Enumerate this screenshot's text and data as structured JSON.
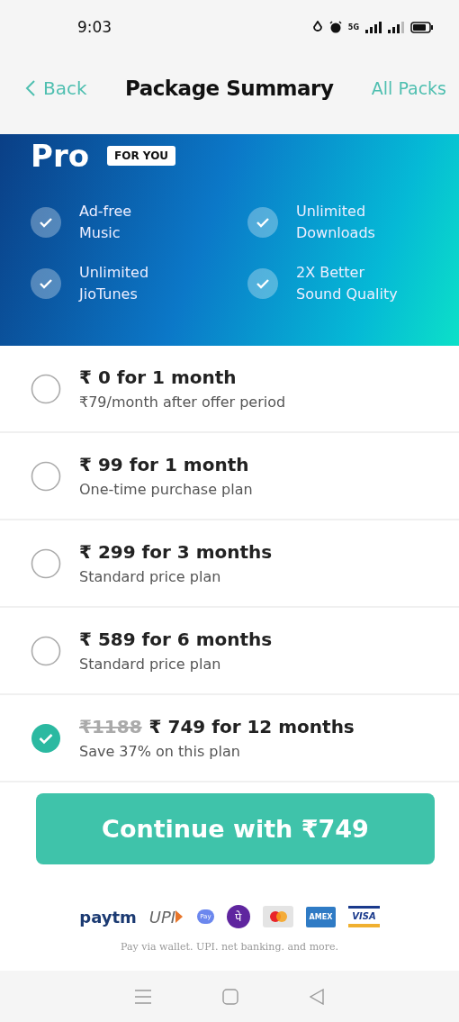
{
  "status_bar": {
    "time": "9:03",
    "network_label": "5G"
  },
  "header": {
    "back": "Back",
    "title": "Package Summary",
    "action": "All Packs"
  },
  "banner": {
    "title": "Pro",
    "badge": "FOR YOU",
    "features": [
      {
        "text": "Ad-free\nMusic"
      },
      {
        "text": "Unlimited\nDownloads"
      },
      {
        "text": "Unlimited\nJioTunes"
      },
      {
        "text": "2X Better\nSound Quality"
      }
    ]
  },
  "plans": [
    {
      "title": "₹ 0 for 1 month",
      "subtitle": "₹79/month after offer period",
      "selected": false
    },
    {
      "title": "₹ 99 for 1 month",
      "subtitle": "One-time purchase plan",
      "selected": false
    },
    {
      "title": "₹ 299 for 3 months",
      "subtitle": "Standard price plan",
      "selected": false
    },
    {
      "title": "₹ 589 for 6 months",
      "subtitle": "Standard price plan",
      "selected": false
    },
    {
      "original_price": "₹1188",
      "title": "₹ 749 for 12 months",
      "subtitle": "Save 37% on this plan",
      "selected": true
    }
  ],
  "continue_button": "Continue with ₹749",
  "payment_methods": [
    {
      "kind": "paytm",
      "label": "paytm"
    },
    {
      "kind": "upi",
      "label": "UPI"
    },
    {
      "kind": "gpay",
      "label": "Pay"
    },
    {
      "kind": "phonepe",
      "label": "पे"
    },
    {
      "kind": "mastercard"
    },
    {
      "kind": "amex",
      "label": "AMEX"
    },
    {
      "kind": "visa",
      "label": "VISA"
    }
  ],
  "payment_note": "Pay via wallet. UPI. net banking. and more."
}
